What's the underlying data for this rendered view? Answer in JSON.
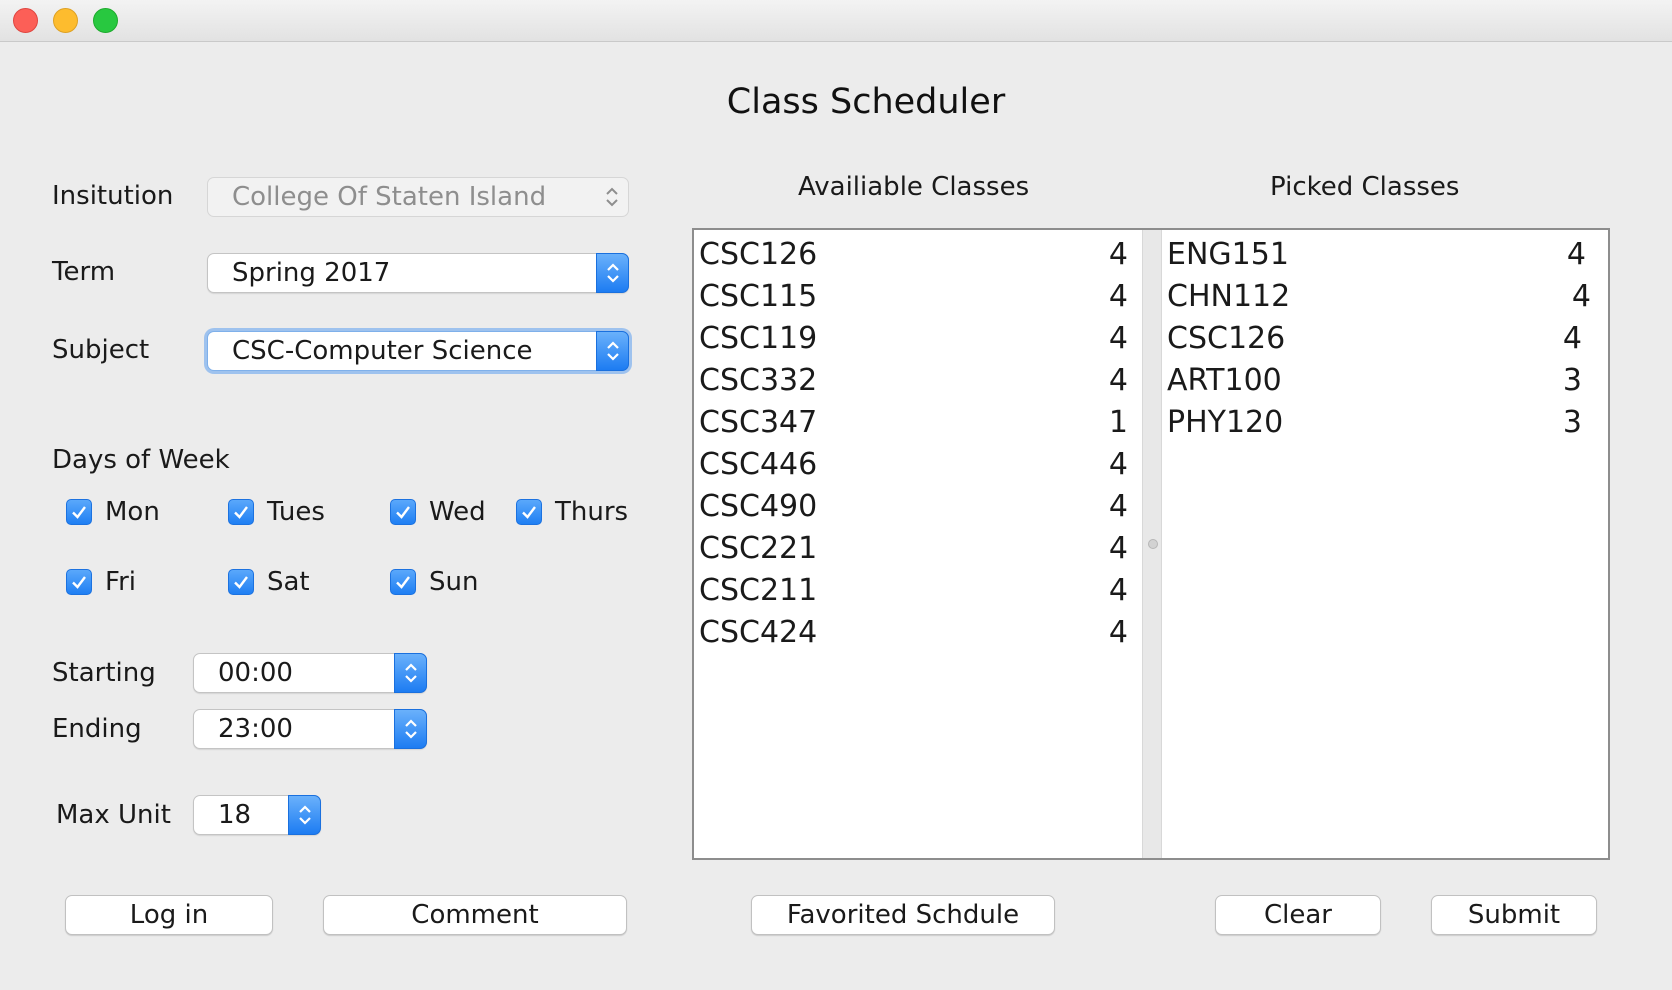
{
  "window": {
    "title": "Class Scheduler"
  },
  "form": {
    "institution": {
      "label": "Insitution",
      "value": "College Of Staten Island",
      "enabled": false
    },
    "term": {
      "label": "Term",
      "value": "Spring 2017"
    },
    "subject": {
      "label": "Subject",
      "value": "CSC-Computer Science"
    },
    "days_label": "Days of Week",
    "days": [
      {
        "label": "Mon",
        "checked": true
      },
      {
        "label": "Tues",
        "checked": true
      },
      {
        "label": "Wed",
        "checked": true
      },
      {
        "label": "Thurs",
        "checked": true
      },
      {
        "label": "Fri",
        "checked": true
      },
      {
        "label": "Sat",
        "checked": true
      },
      {
        "label": "Sun",
        "checked": true
      }
    ],
    "starting": {
      "label": "Starting",
      "value": "00:00"
    },
    "ending": {
      "label": "Ending",
      "value": "23:00"
    },
    "max_unit": {
      "label": "Max Unit",
      "value": "18"
    }
  },
  "available": {
    "header": "Availiable Classes",
    "items": [
      {
        "code": "CSC126",
        "units": "4"
      },
      {
        "code": "CSC115",
        "units": "4"
      },
      {
        "code": "CSC119",
        "units": "4"
      },
      {
        "code": "CSC332",
        "units": "4"
      },
      {
        "code": "CSC347",
        "units": "1"
      },
      {
        "code": "CSC446",
        "units": "4"
      },
      {
        "code": "CSC490",
        "units": "4"
      },
      {
        "code": "CSC221",
        "units": "4"
      },
      {
        "code": "CSC211",
        "units": "4"
      },
      {
        "code": "CSC424",
        "units": "4"
      }
    ]
  },
  "picked": {
    "header": "Picked Classes",
    "items": [
      {
        "code": "ENG151",
        "units": "4"
      },
      {
        "code": "CHN112",
        "units": "4"
      },
      {
        "code": "CSC126",
        "units": "4"
      },
      {
        "code": "ART100",
        "units": "3"
      },
      {
        "code": "PHY120",
        "units": "3"
      }
    ]
  },
  "buttons": {
    "login": "Log in",
    "comment": "Comment",
    "favorited": "Favorited Schdule",
    "clear": "Clear",
    "submit": "Submit"
  },
  "colors": {
    "accent": "#1f7ff3",
    "window_bg": "#ececec"
  }
}
